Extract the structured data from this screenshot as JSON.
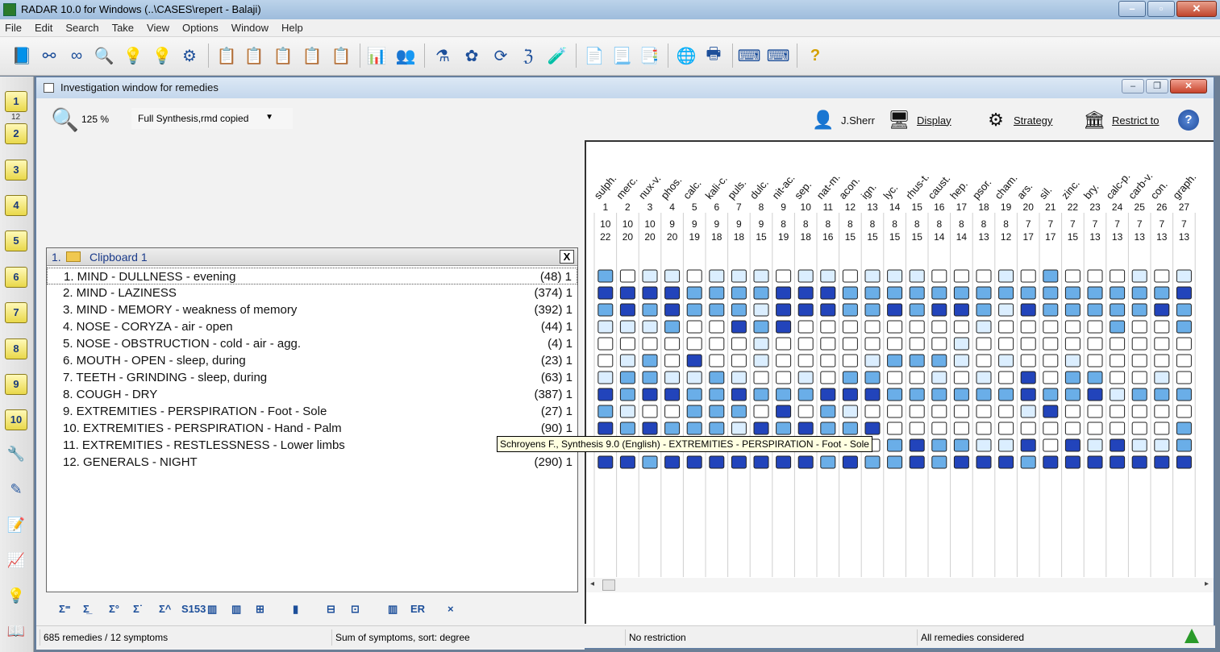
{
  "app": {
    "title": "RADAR 10.0 for Windows  (..\\CASES\\repert - Balaji)",
    "menu": [
      "File",
      "Edit",
      "Search",
      "Take",
      "View",
      "Options",
      "Window",
      "Help"
    ]
  },
  "left_toolbar": {
    "clipboards": [
      "1",
      "2",
      "3",
      "4",
      "5",
      "6",
      "7",
      "8",
      "9",
      "10"
    ],
    "sub_count": "12"
  },
  "child": {
    "title": "Investigation window for remedies",
    "zoom": "125 %",
    "source": "Full Synthesis,rmd copied",
    "author": "J.Sherr",
    "display_label": "Display",
    "strategy_label": "Strategy",
    "restrict_label": "Restrict to"
  },
  "clipboard": {
    "number": "1.",
    "label": "Clipboard 1",
    "close": "X"
  },
  "symptoms": [
    {
      "text": "1. MIND - DULLNESS - evening",
      "count": "(48) 1"
    },
    {
      "text": "2. MIND - LAZINESS",
      "count": "(374) 1"
    },
    {
      "text": "3. MIND - MEMORY - weakness of memory",
      "count": "(392) 1"
    },
    {
      "text": "4. NOSE - CORYZA - air - open",
      "count": "(44) 1"
    },
    {
      "text": "5. NOSE - OBSTRUCTION - cold - air - agg.",
      "count": "(4) 1"
    },
    {
      "text": "6. MOUTH - OPEN - sleep, during",
      "count": "(23) 1"
    },
    {
      "text": "7. TEETH - GRINDING - sleep, during",
      "count": "(63) 1"
    },
    {
      "text": "8. COUGH - DRY",
      "count": "(387) 1"
    },
    {
      "text": "9. EXTREMITIES - PERSPIRATION - Foot - Sole",
      "count": "(27) 1"
    },
    {
      "text": "10. EXTREMITIES - PERSPIRATION - Hand - Palm",
      "count": "(90) 1"
    },
    {
      "text": "11. EXTREMITIES - RESTLESSNESS - Lower limbs",
      "count": "(40) 1"
    },
    {
      "text": "12. GENERALS - NIGHT",
      "count": "(290) 1"
    }
  ],
  "remedies": [
    {
      "name": "sulph.",
      "rank": "1",
      "symptoms": "10",
      "degree": "22"
    },
    {
      "name": "merc.",
      "rank": "2",
      "symptoms": "10",
      "degree": "20"
    },
    {
      "name": "nux-v.",
      "rank": "3",
      "symptoms": "10",
      "degree": "20"
    },
    {
      "name": "phos.",
      "rank": "4",
      "symptoms": "9",
      "degree": "20"
    },
    {
      "name": "calc.",
      "rank": "5",
      "symptoms": "9",
      "degree": "19"
    },
    {
      "name": "kali-c.",
      "rank": "6",
      "symptoms": "9",
      "degree": "18"
    },
    {
      "name": "puls.",
      "rank": "7",
      "symptoms": "9",
      "degree": "18"
    },
    {
      "name": "dulc.",
      "rank": "8",
      "symptoms": "9",
      "degree": "15"
    },
    {
      "name": "nit-ac.",
      "rank": "9",
      "symptoms": "8",
      "degree": "19"
    },
    {
      "name": "sep.",
      "rank": "10",
      "symptoms": "8",
      "degree": "18"
    },
    {
      "name": "nat-m.",
      "rank": "11",
      "symptoms": "8",
      "degree": "16"
    },
    {
      "name": "acon.",
      "rank": "12",
      "symptoms": "8",
      "degree": "15"
    },
    {
      "name": "ign.",
      "rank": "13",
      "symptoms": "8",
      "degree": "15"
    },
    {
      "name": "lyc.",
      "rank": "14",
      "symptoms": "8",
      "degree": "15"
    },
    {
      "name": "rhus-t.",
      "rank": "15",
      "symptoms": "8",
      "degree": "15"
    },
    {
      "name": "caust.",
      "rank": "16",
      "symptoms": "8",
      "degree": "14"
    },
    {
      "name": "hep.",
      "rank": "17",
      "symptoms": "8",
      "degree": "14"
    },
    {
      "name": "psor.",
      "rank": "18",
      "symptoms": "8",
      "degree": "13"
    },
    {
      "name": "cham.",
      "rank": "19",
      "symptoms": "8",
      "degree": "12"
    },
    {
      "name": "ars.",
      "rank": "20",
      "symptoms": "7",
      "degree": "17"
    },
    {
      "name": "sil.",
      "rank": "21",
      "symptoms": "7",
      "degree": "17"
    },
    {
      "name": "zinc.",
      "rank": "22",
      "symptoms": "7",
      "degree": "15"
    },
    {
      "name": "bry.",
      "rank": "23",
      "symptoms": "7",
      "degree": "13"
    },
    {
      "name": "calc-p.",
      "rank": "24",
      "symptoms": "7",
      "degree": "13"
    },
    {
      "name": "carb-v.",
      "rank": "25",
      "symptoms": "7",
      "degree": "13"
    },
    {
      "name": "con.",
      "rank": "26",
      "symptoms": "7",
      "degree": "13"
    },
    {
      "name": "graph.",
      "rank": "27",
      "symptoms": "7",
      "degree": "13"
    }
  ],
  "grid_levels": [
    [
      2,
      0,
      1,
      1,
      0,
      1,
      1,
      1,
      0,
      1,
      1,
      0,
      1,
      1,
      1,
      0,
      0,
      0,
      1,
      0,
      2,
      0,
      0,
      0,
      1,
      0,
      1
    ],
    [
      3,
      3,
      3,
      3,
      2,
      2,
      2,
      2,
      3,
      3,
      3,
      2,
      2,
      2,
      2,
      2,
      2,
      2,
      2,
      2,
      2,
      2,
      2,
      2,
      2,
      2,
      3
    ],
    [
      2,
      3,
      2,
      3,
      2,
      2,
      2,
      1,
      3,
      3,
      3,
      2,
      2,
      3,
      2,
      3,
      3,
      2,
      1,
      3,
      2,
      2,
      2,
      2,
      2,
      3,
      2
    ],
    [
      1,
      1,
      1,
      2,
      0,
      0,
      3,
      2,
      3,
      0,
      0,
      0,
      0,
      0,
      0,
      0,
      0,
      1,
      0,
      0,
      0,
      0,
      0,
      2,
      0,
      0,
      2
    ],
    [
      0,
      0,
      0,
      0,
      0,
      0,
      0,
      1,
      0,
      0,
      0,
      0,
      0,
      0,
      0,
      0,
      1,
      0,
      0,
      0,
      0,
      0,
      0,
      0,
      0,
      0,
      0
    ],
    [
      0,
      1,
      2,
      0,
      3,
      0,
      0,
      1,
      0,
      0,
      0,
      0,
      1,
      2,
      2,
      2,
      1,
      0,
      1,
      0,
      0,
      1,
      0,
      0,
      0,
      0,
      0
    ],
    [
      1,
      2,
      2,
      1,
      1,
      2,
      1,
      0,
      0,
      1,
      0,
      2,
      2,
      0,
      0,
      1,
      0,
      1,
      0,
      3,
      0,
      2,
      2,
      0,
      0,
      1,
      0
    ],
    [
      3,
      2,
      3,
      3,
      2,
      2,
      3,
      2,
      2,
      2,
      3,
      3,
      3,
      2,
      2,
      2,
      2,
      2,
      2,
      3,
      2,
      2,
      3,
      1,
      2,
      2,
      2
    ],
    [
      2,
      1,
      0,
      0,
      2,
      2,
      2,
      0,
      3,
      0,
      2,
      1,
      0,
      0,
      0,
      0,
      0,
      0,
      0,
      1,
      3,
      0,
      0,
      0,
      0,
      0,
      0
    ],
    [
      3,
      2,
      3,
      2,
      2,
      2,
      1,
      3,
      2,
      3,
      2,
      2,
      3,
      0,
      0,
      0,
      0,
      0,
      0,
      0,
      0,
      0,
      0,
      0,
      0,
      0,
      2
    ],
    [
      0,
      0,
      0,
      0,
      0,
      0,
      0,
      0,
      0,
      0,
      0,
      0,
      0,
      2,
      3,
      2,
      2,
      1,
      1,
      3,
      0,
      3,
      1,
      3,
      1,
      1,
      2
    ],
    [
      3,
      3,
      2,
      3,
      3,
      3,
      3,
      3,
      3,
      3,
      2,
      3,
      2,
      2,
      3,
      2,
      3,
      3,
      3,
      2,
      3,
      3,
      3,
      3,
      3,
      3,
      3
    ]
  ],
  "colors": {
    "level0": "#ffffff",
    "level1": "#dbeeff",
    "level2": "#6aaee8",
    "level3": "#2244bb",
    "border": "#222222"
  },
  "bottom_toolbar": [
    "Σ⁼",
    "Σ̲",
    "Σ°",
    "Σ˙",
    "Σ^",
    "S153",
    "▥",
    "▥",
    "⊞",
    "▮",
    "⊟",
    "⊡",
    "▥",
    "ER",
    "×"
  ],
  "tooltip": "Schroyens F., Synthesis 9.0 (English) - EXTREMITIES - PERSPIRATION - Foot - Sole",
  "status": {
    "remedies": "685 remedies / 12 symptoms",
    "sort": "Sum of symptoms, sort: degree",
    "restriction": "No restriction",
    "considered": "All remedies considered"
  }
}
